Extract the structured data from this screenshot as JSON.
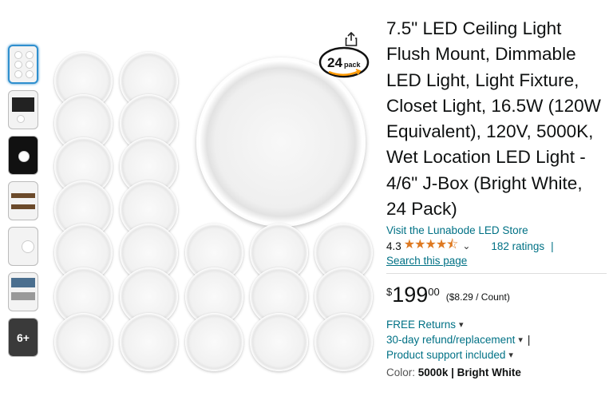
{
  "product": {
    "title": "7.5\" LED Ceiling Light Flush Mount, Dimmable LED Light, Light Fixture, Closet Light, 16.5W (120W Equivalent), 120V, 5000K, Wet Location LED Light - 4/6\" J-Box (Bright White, 24 Pack)",
    "store_link": "Visit the Lunabode LED Store",
    "rating_value": "4.3",
    "stars": "★★★★⯪",
    "ratings_count": "182 ratings",
    "separator": "|",
    "search_page": "Search this page",
    "price": {
      "currency": "$",
      "whole": "199",
      "fraction": "00",
      "per_unit": "($8.29 / Count)"
    },
    "free_returns": "FREE Returns",
    "refund": "30-day refund/replacement",
    "support": "Product support included",
    "color_label": "Color:",
    "color_value": "5000k | Bright White"
  },
  "gallery": {
    "more_label": "6+",
    "badge_text": "24pack",
    "accent": "#ff9900"
  },
  "colors": {
    "link": "#007185",
    "star": "#de7921",
    "thumb_active": "#2f8fce"
  }
}
